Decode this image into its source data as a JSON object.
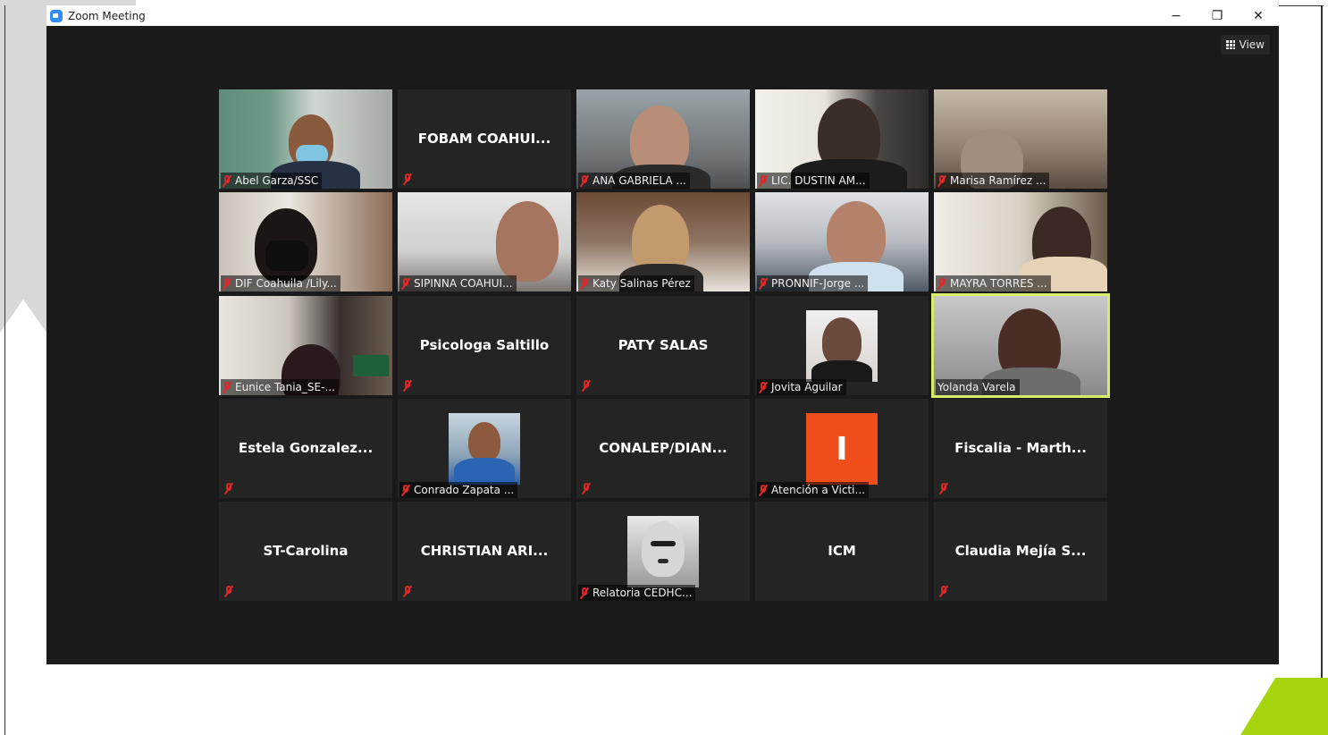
{
  "window": {
    "title": "Zoom Meeting",
    "controls": {
      "minimize": "−",
      "restore": "❐",
      "close": "✕"
    },
    "view_button": "View"
  },
  "participants": [
    {
      "name": "Abel Garza/SSC",
      "display": "video",
      "muted": true
    },
    {
      "name": "FOBAM  COAHUI...",
      "display": "name",
      "muted": true
    },
    {
      "name": "ANA GABRIELA ...",
      "display": "video",
      "muted": true
    },
    {
      "name": "LIC. DUSTIN AM...",
      "display": "video",
      "muted": true
    },
    {
      "name": "Marisa Ramírez ...",
      "display": "video",
      "muted": true
    },
    {
      "name": "DIF Coahuila /Lily...",
      "display": "video",
      "muted": true
    },
    {
      "name": "SIPINNA COAHUI...",
      "display": "video",
      "muted": true
    },
    {
      "name": "Katy Salinas Pérez",
      "display": "video",
      "muted": true
    },
    {
      "name": "PRONNIF-Jorge ...",
      "display": "video",
      "muted": true
    },
    {
      "name": "MAYRA TORRES ...",
      "display": "video",
      "muted": true
    },
    {
      "name": "Eunice Tania_SE-...",
      "display": "video",
      "muted": true
    },
    {
      "name": "Psicologa Saltillo",
      "display": "name",
      "muted": true
    },
    {
      "name": "PATY SALAS",
      "display": "name",
      "muted": true
    },
    {
      "name": "Jovita Aguilar",
      "display": "photo",
      "muted": true
    },
    {
      "name": "Yolanda Varela",
      "display": "video",
      "muted": false,
      "active_speaker": true
    },
    {
      "name": "Estela  Gonzalez...",
      "display": "name",
      "muted": true
    },
    {
      "name": "Conrado Zapata ...",
      "display": "photo",
      "muted": true
    },
    {
      "name": "CONALEP/DIAN...",
      "display": "name",
      "muted": true
    },
    {
      "name": "Atención a Victi...",
      "display": "initial",
      "initial": "I",
      "muted": true
    },
    {
      "name": "Fiscalia  -  Marth...",
      "display": "name",
      "muted": true
    },
    {
      "name": "ST-Carolina",
      "display": "name",
      "muted": true
    },
    {
      "name": "CHRISTIAN  ARI...",
      "display": "name",
      "muted": true
    },
    {
      "name": "Relatoria CEDHC...",
      "display": "photo",
      "muted": true
    },
    {
      "name": "ICM",
      "display": "name",
      "muted": false
    },
    {
      "name": "Claudia  Mejía  S...",
      "display": "name",
      "muted": true
    }
  ],
  "colors": {
    "zoom_background": "#1a1a1a",
    "tile_background": "#242424",
    "active_speaker_border": "#d8ec6a",
    "muted_icon": "#e02828",
    "accent_green": "#a6d40f"
  }
}
